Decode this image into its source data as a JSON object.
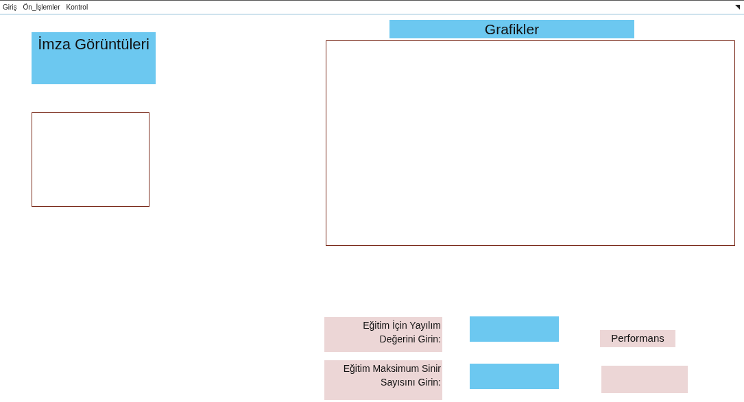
{
  "menu": [
    {
      "label": "Giriş"
    },
    {
      "label": "Ön_İşlemler"
    },
    {
      "label": "Kontrol"
    }
  ],
  "signature_panel": {
    "title": "İmza Görüntüleri"
  },
  "charts_panel": {
    "title": "Grafikler"
  },
  "form_rows": [
    {
      "label_line1": "Eğitim İçin Yayılım",
      "label_line2": "Değerini Girin:"
    },
    {
      "label_line1": "Eğitim Maksimum Sinir",
      "label_line2": "Sayısını Girin:"
    }
  ],
  "performance": {
    "label": "Performans"
  }
}
